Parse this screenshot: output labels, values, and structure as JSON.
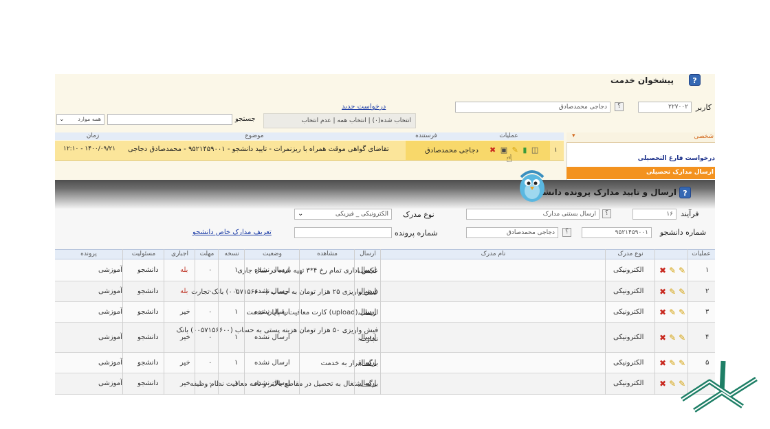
{
  "colors": {
    "accent_orange": "#f3921f",
    "header_blue": "#e4ecf7",
    "highlight_row": "#fbe59a",
    "help_blue": "#3568b3"
  },
  "top_window": {
    "title": "پیشخوان خدمت",
    "user_label": "کاربر",
    "user_code": "۲۲۷۰۰۲",
    "user_name": "دجاجی محمدصادق",
    "sidebar_header": "شخصی",
    "sidebar_items": [
      "درخواست فارغ التحصیلی",
      "ارسال مدارک تحصیلی"
    ],
    "new_request_link": "درخواست جدید",
    "selection_text": "انتخاب شده(۰) | انتخاب همه | عدم انتخاب",
    "search_label": "جستجو",
    "filter_value": "همه موارد",
    "grid_headers": {
      "ops": "عملیات",
      "sender": "فرستنده",
      "subject": "موضوع",
      "time": "زمان"
    },
    "row": {
      "index": "۱",
      "sender": "دجاجی محمدصادق",
      "subject": "تقاضای گواهی موقت همراه با ریزنمرات - تایید دانشجو - ۹۵۲۱۴۵۹۰۰۱ - محمدصادق دجاجی",
      "time": "۱۴۰۰/۰۹/۲۱ - ۱۲:۱۰"
    }
  },
  "doc_window": {
    "title": "ارسال و تایید مدارک پرونده دانشجو",
    "process_label": "فرآیند",
    "process_code": "۱۶",
    "process_name": "ارسال بستنی مدارک",
    "doc_type_label": "نوع مدرک",
    "doc_type_value": "الکترونیکی _ فیزیکی",
    "student_no_label": "شماره دانشجو",
    "student_no": "۹۵۲۱۴۵۹۰۰۱",
    "student_name": "دجاجی محمدصادق",
    "file_no_label": "شماره پرونده",
    "define_link": "تعریف مدارک خاص دانشجو",
    "headers": [
      "عملیات",
      "نوع مدرک",
      "نام مدرک",
      "ارسال",
      "مشاهده",
      "وضعیت",
      "نسخه",
      "مهلت",
      "اجباری",
      "مسئولیت",
      "پرونده"
    ],
    "rows": [
      {
        "n": "۱",
        "type": "الکترونیکی",
        "name": "عکس اداری تمام رخ ۴*۳ تهیه شده در سال جاری",
        "send": "ارسال",
        "status": "ارسال نشده",
        "copy": "۱",
        "deadline": "۰",
        "required": "بله",
        "resp": "دانشجو",
        "file": "آموزشی"
      },
      {
        "n": "۲",
        "type": "الکترونیکی",
        "name": "فیش واریزی ۲۵ هزار تومان به حساب (۰۰۵۷۱۵۶۶۰۰) بانک تجارت",
        "send": "ارسال",
        "status": "ارسال نشده",
        "copy": "۱",
        "deadline": "۰",
        "required": "بله",
        "resp": "دانشجو",
        "file": "آموزشی"
      },
      {
        "n": "۳",
        "type": "الکترونیکی",
        "name": "ارسال (upload) کارت معافیت یا پایان خدمت",
        "send": "ارسال",
        "status": "ارسال نشده",
        "copy": "۱",
        "deadline": "۰",
        "required": "خیر",
        "resp": "دانشجو",
        "file": "آموزشی"
      },
      {
        "n": "۴",
        "type": "الکترونیکی",
        "name": "فیش واریزی ۵۰ هزار تومان هزینه پستی به حساب (۰۰۵۷۱۵۶۶۰۰) بانک تجارت",
        "send": "ارسال",
        "status": "ارسال نشده",
        "copy": "۱",
        "deadline": "۰",
        "required": "خیر",
        "resp": "دانشجو",
        "file": "آموزشی"
      },
      {
        "n": "۵",
        "type": "الکترونیکی",
        "name": "برگه اقرار به خدمت",
        "send": "ارسال",
        "status": "ارسال نشده",
        "copy": "۱",
        "deadline": "۰",
        "required": "خیر",
        "resp": "دانشجو",
        "file": "آموزشی"
      },
      {
        "n": "۶",
        "type": "الکترونیکی",
        "name": "برگه اشتغال به تحصیل در مقاطع بالاتر و نامه معافیت نظام وظیفه",
        "send": "ارسال",
        "status": "ارسال نشده",
        "copy": "۱",
        "deadline": "۰",
        "required": "خیر",
        "resp": "دانشجو",
        "file": "آموزشی"
      }
    ]
  },
  "icons": [
    "help-icon",
    "pencil-icon",
    "delete-icon",
    "cursor-icon",
    "bird-mascot-icon",
    "logo-icon"
  ]
}
